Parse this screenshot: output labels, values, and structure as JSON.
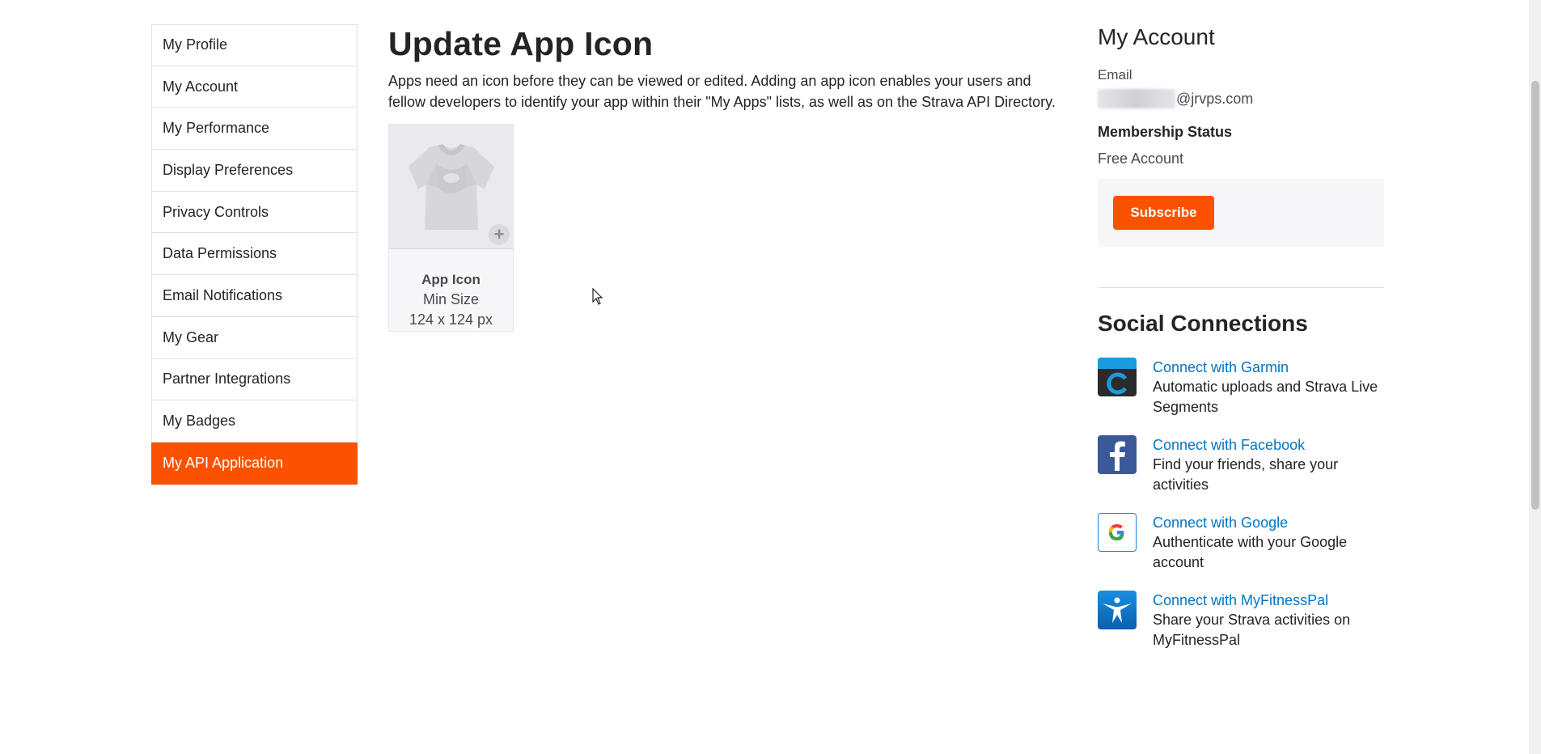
{
  "sidebar": {
    "items": [
      {
        "label": "My Profile"
      },
      {
        "label": "My Account"
      },
      {
        "label": "My Performance"
      },
      {
        "label": "Display Preferences"
      },
      {
        "label": "Privacy Controls"
      },
      {
        "label": "Data Permissions"
      },
      {
        "label": "Email Notifications"
      },
      {
        "label": "My Gear"
      },
      {
        "label": "Partner Integrations"
      },
      {
        "label": "My Badges"
      },
      {
        "label": "My API Application",
        "active": true
      }
    ]
  },
  "main": {
    "title": "Update App Icon",
    "intro_line1": "Apps need an icon before they can be viewed or edited. Adding an app icon enables your users and",
    "intro_line2": "fellow developers to identify your app within their \"My Apps\" lists, as well as on the Strava API Directory.",
    "icon_card": {
      "title": "App Icon",
      "line1": "Min Size",
      "line2": "124 x 124 px"
    }
  },
  "account": {
    "title": "My Account",
    "email_label": "Email",
    "email_suffix": "@jrvps.com",
    "membership_label": "Membership Status",
    "membership_value": "Free Account",
    "subscribe_label": "Subscribe"
  },
  "social": {
    "title": "Social Connections",
    "connections": [
      {
        "link": "Connect with Garmin",
        "desc": "Automatic uploads and Strava Live Segments",
        "icon": "garmin-icon"
      },
      {
        "link": "Connect with Facebook",
        "desc": "Find your friends, share your activities",
        "icon": "facebook-icon"
      },
      {
        "link": "Connect with Google",
        "desc": "Authenticate with your Google account",
        "icon": "google-icon"
      },
      {
        "link": "Connect with MyFitnessPal",
        "desc": "Share your Strava activities on MyFitnessPal",
        "icon": "myfitnesspal-icon"
      }
    ]
  },
  "colors": {
    "accent": "#fc5200",
    "link": "#0075c4"
  }
}
